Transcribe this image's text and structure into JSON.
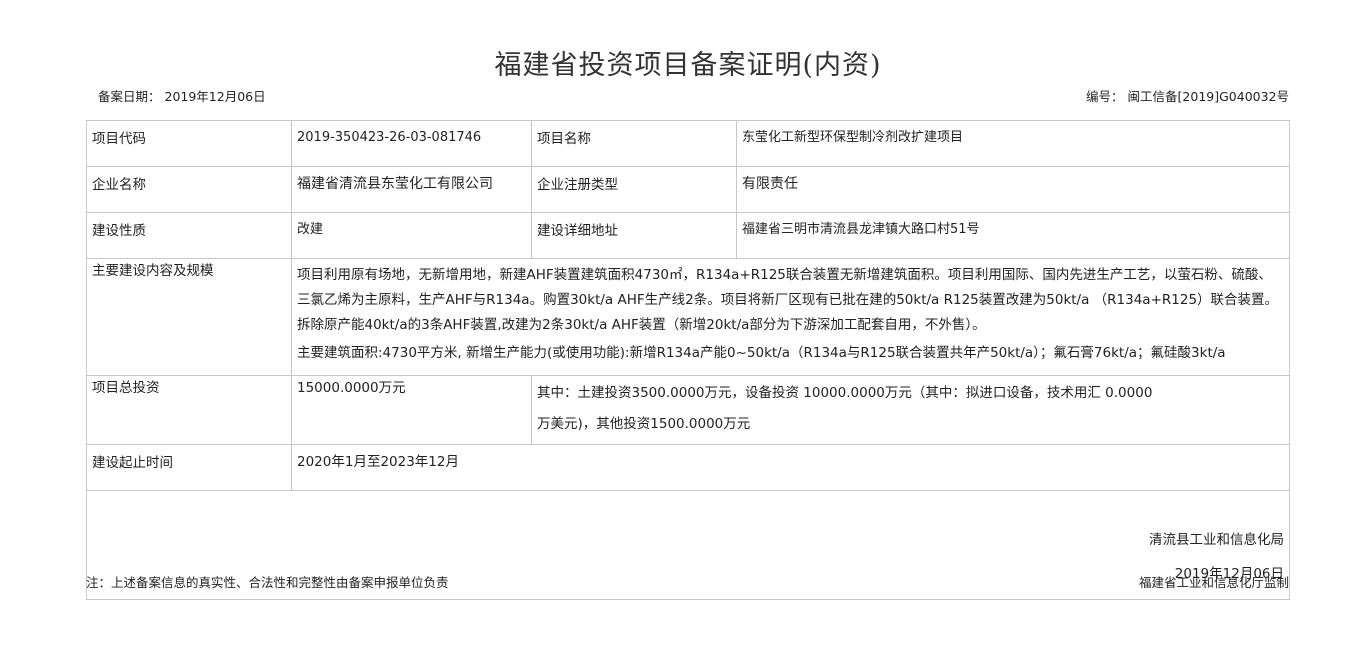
{
  "title": "福建省投资项目备案证明(内资)",
  "record_date_label": "备案日期：",
  "record_date_value": "2019年12月06日",
  "record_number_label": "编号：",
  "record_number_value": "闽工信备[2019]G040032号",
  "table": {
    "project_code_label": "项目代码",
    "project_code_value": "2019-350423-26-03-081746",
    "project_name_label": "项目名称",
    "project_name_value": "东莹化工新型环保型制冷剂改扩建项目",
    "company_name_label": "企业名称",
    "company_name_value": "福建省清流县东莹化工有限公司",
    "company_type_label": "企业注册类型",
    "company_type_value": "有限责任",
    "construction_nature_label": "建设性质",
    "construction_nature_value": "改建",
    "address_label": "建设详细地址",
    "address_value": "福建省三明市清流县龙津镇大路口村51号",
    "scale_label": "主要建设内容及规模",
    "scale_paragraph": "项目利用原有场地，无新增用地，新建AHF装置建筑面积4730㎡，R134a+R125联合装置无新增建筑面积。项目利用国际、国内先进生产工艺，以萤石粉、硫酸、三氯乙烯为主原料，生产AHF与R134a。购置30kt/a AHF生产线2条。项目将新厂区现有已批在建的50kt/a R125装置改建为50kt/a （R134a+R125）联合装置。拆除原产能40kt/a的3条AHF装置,改建为2条30kt/a AHF装置（新增20kt/a部分为下游深加工配套自用，不外售）。",
    "scale_summary": "主要建筑面积:4730平方米, 新增生产能力(或使用功能):新增R134a产能0~50kt/a（R134a与R125联合装置共年产50kt/a）；氟石膏76kt/a；氟硅酸3kt/a",
    "total_investment_label": "项目总投资",
    "total_investment_value": "15000.0000万元",
    "investment_detail_line1": "其中：土建投资3500.0000万元，设备投资 10000.0000万元（其中：拟进口设备，技术用汇 0.0000",
    "investment_detail_line2": "万美元)，其他投资1500.0000万元",
    "period_label": "建设起止时间",
    "period_value": "2020年1月至2023年12月",
    "signature_org": "清流县工业和信息化局",
    "signature_date": "2019年12月06日"
  },
  "footnote": "注：上述备案信息的真实性、合法性和完整性由备案申报单位负责",
  "supervision": "福建省工业和信息化厅监制"
}
